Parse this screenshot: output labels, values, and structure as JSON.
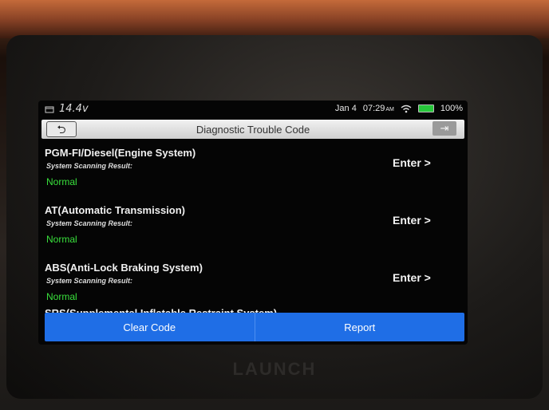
{
  "status": {
    "voltage": "14.4v",
    "date": "Jan 4",
    "time": "07:29",
    "ampm": "AM",
    "battery": "100%"
  },
  "header": {
    "title": "Diagnostic Trouble Code",
    "back_icon": "back-arrow-icon",
    "exit_icon": "exit-icon"
  },
  "systems": [
    {
      "name": "PGM-FI/Diesel(Engine System)",
      "scan_label": "System Scanning Result:",
      "result": "Normal",
      "enter": "Enter >"
    },
    {
      "name": "AT(Automatic Transmission)",
      "scan_label": "System Scanning Result:",
      "result": "Normal",
      "enter": "Enter >"
    },
    {
      "name": "ABS(Anti-Lock Braking System)",
      "scan_label": "System Scanning Result:",
      "result": "Normal",
      "enter": "Enter >"
    },
    {
      "name": "SRS(Supplemental Inflatable Restraint System)"
    }
  ],
  "actions": {
    "clear_code": "Clear Code",
    "report": "Report"
  },
  "brand": "LAUNCH",
  "colors": {
    "accent": "#1f6ee6",
    "normal": "#39e03c",
    "battery": "#27c73b"
  }
}
